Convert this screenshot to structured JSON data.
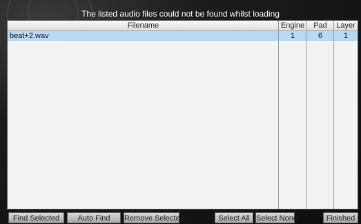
{
  "dialog": {
    "title": "The listed audio files could not be found whilst loading"
  },
  "table": {
    "columns": {
      "filename": "Filename",
      "engine": "Engine",
      "pad": "Pad",
      "layer": "Layer"
    },
    "rows": [
      {
        "filename": "beat+2.wav",
        "engine": "1",
        "pad": "6",
        "layer": "1",
        "selected": true
      }
    ],
    "selection_color": "#b8d8f5"
  },
  "buttons": {
    "find_selected": "Find Selected",
    "auto_find": "Auto Find",
    "remove_selected": "Remove Selected",
    "select_all": "Select All",
    "select_none": "Select None",
    "finished": "Finished"
  }
}
